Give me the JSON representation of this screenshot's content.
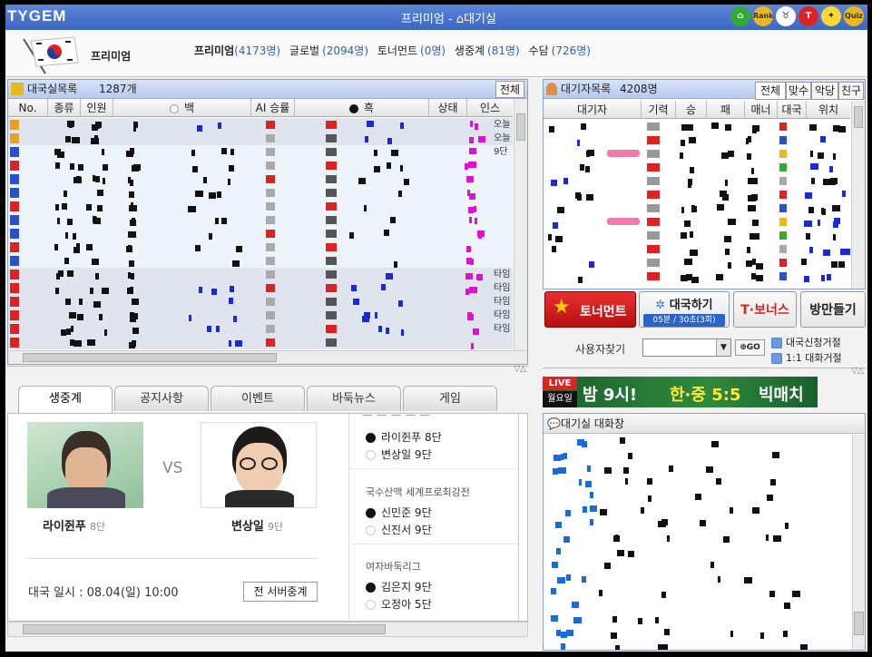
{
  "app": {
    "logo": "TYGEM",
    "title": "프리미엄 - ",
    "location": "대기실",
    "icons": [
      "home-icon",
      "rank-icon",
      "cow-icon",
      "t-icon",
      "bulb-icon",
      "quiz-icon"
    ],
    "rank_label": "Rank",
    "quiz_label": "Quiz"
  },
  "subbar": {
    "tag": "프리미엄",
    "stats": [
      {
        "label": "프리미엄",
        "count": "(4173명)"
      },
      {
        "label": "글로벌",
        "count": "(2094명)"
      },
      {
        "label": "토너먼트",
        "count": "(0명)"
      },
      {
        "label": "생중계",
        "count": "(81명)"
      },
      {
        "label": "수담",
        "count": "(726명)"
      }
    ]
  },
  "rooms": {
    "title": "대국실목록",
    "count": "1287개",
    "all_button": "전체",
    "columns": [
      "No.",
      "종류",
      "인원",
      "백",
      "AI 승률",
      "흑",
      "상태",
      "인스"
    ],
    "row_partial": {
      "no": "101",
      "kind": "단판",
      "people": "17"
    },
    "status_labels": [
      "오늘",
      "오늘",
      "9단"
    ],
    "lower_status_labels": [
      "타임",
      "타임",
      "타임",
      "타임",
      "타임"
    ]
  },
  "waiters": {
    "title": "대기자목록",
    "count": "4208명",
    "tabs": [
      "전체",
      "맞수",
      "악당",
      "친구"
    ],
    "columns": [
      "대기자",
      "기력",
      "승",
      "패",
      "매너",
      "대국",
      "위치"
    ]
  },
  "actions": {
    "tournament": "토너먼트",
    "play": "대국하기",
    "play_sub": "05분 / 30초(3회)",
    "bonus": "T·보너스",
    "make_room": "방만들기",
    "find_user": "사용자찾기",
    "go": "GO",
    "refuse_game": "대국신청거절",
    "refuse_chat": "1:1 대화거절"
  },
  "banner": {
    "live": "LIVE",
    "day": "월요일",
    "time": "밤 9시!",
    "match": "한·중 5:5",
    "event": "빅매치"
  },
  "chat": {
    "title": "대기실 대화창"
  },
  "bottom_tabs": [
    "생중계",
    "공지사항",
    "이벤트",
    "바둑뉴스",
    "게임"
  ],
  "live": {
    "player1": {
      "name": "라이쥔푸",
      "rank": "8단"
    },
    "vs": "VS",
    "player2": {
      "name": "변상일",
      "rank": "9단"
    },
    "date_label": "대국 일시 : 08.04(일) 10:00",
    "relay_button": "전 서버중계"
  },
  "games": [
    {
      "title": "",
      "black": "라이쥔푸 8단",
      "white": "변상일 9단"
    },
    {
      "title": "국수산맥 세계프로최강전",
      "black": "신민준 9단",
      "white": "신진서 9단"
    },
    {
      "title": "여자바둑리그",
      "black": "김은지 9단",
      "white": "오정아 5단"
    }
  ],
  "colors": {
    "title_blue": "#4a73cc",
    "accent_red": "#d81c1c",
    "count_blue": "#2a5fc4"
  }
}
